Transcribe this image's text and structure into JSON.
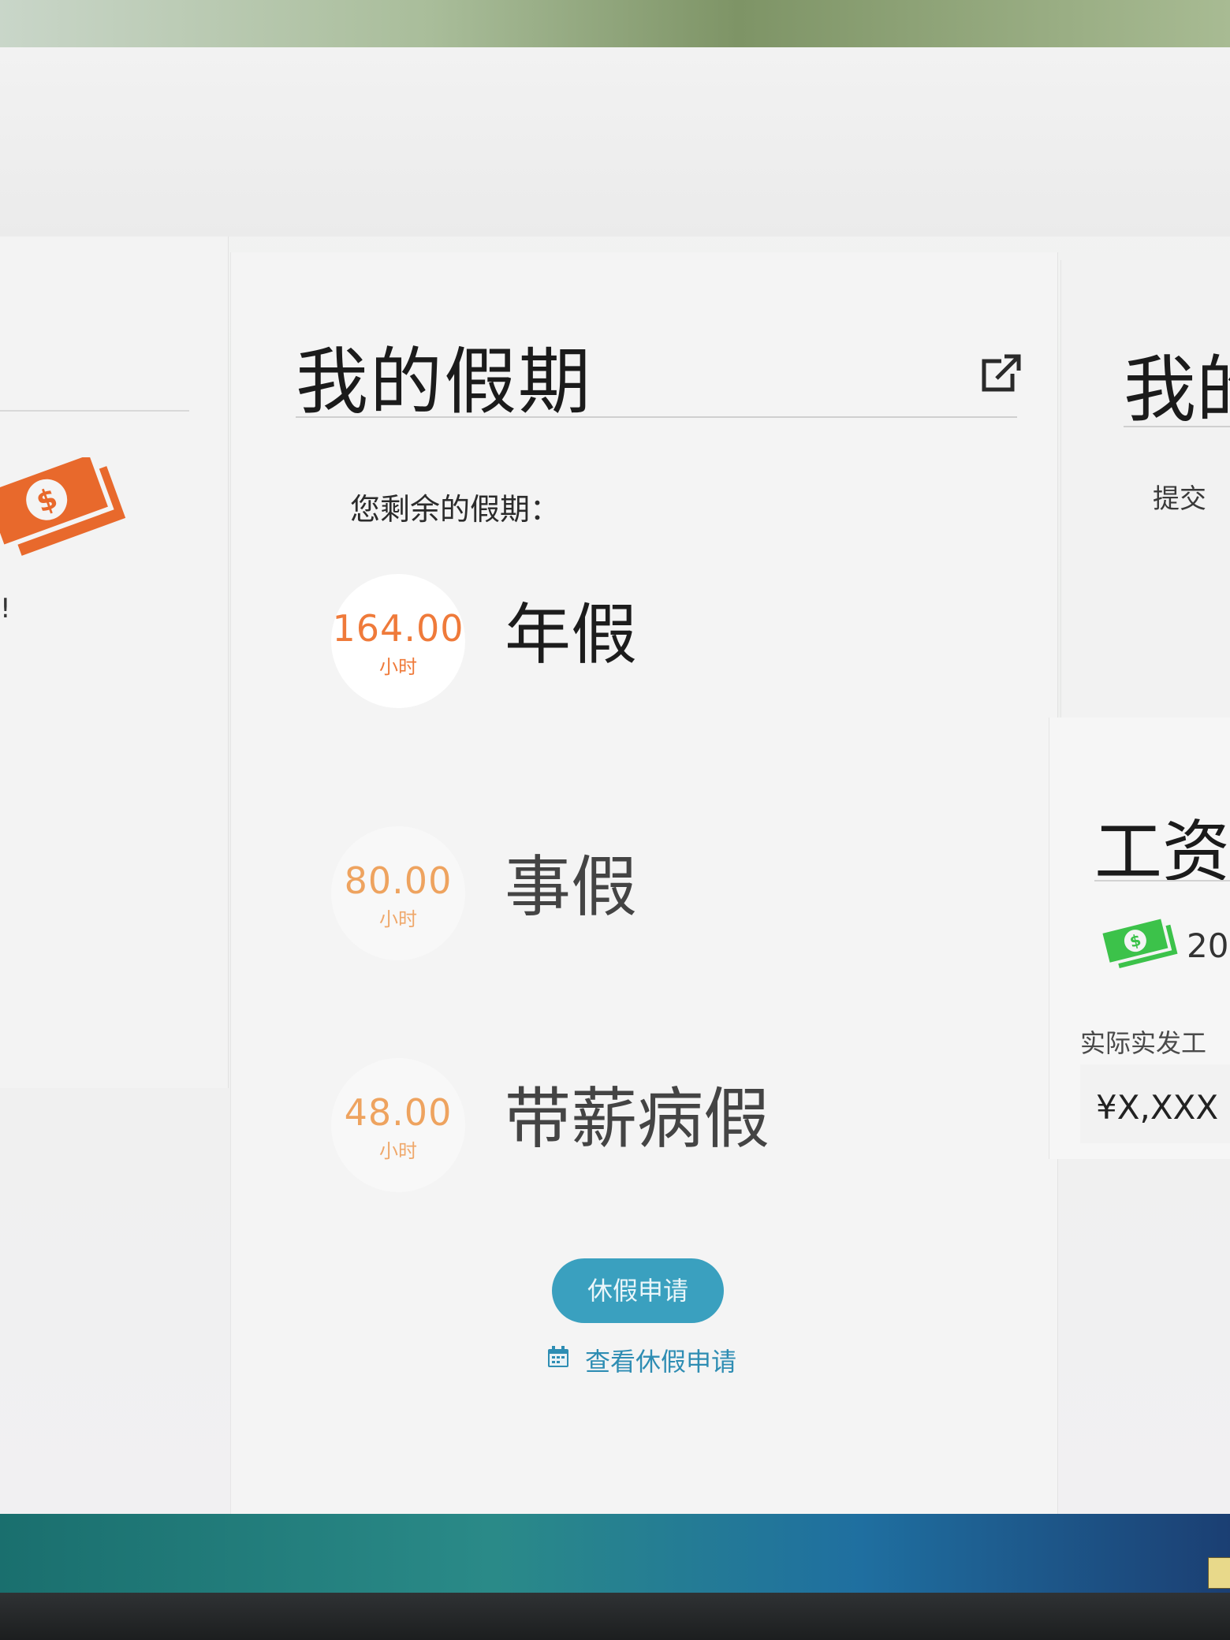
{
  "vacation_card": {
    "title": "我的假期",
    "remaining_label": "您剩余的假期：",
    "leaves": [
      {
        "hours": "164.00",
        "unit": "小时",
        "name": "年假"
      },
      {
        "hours": "80.00",
        "unit": "小时",
        "name": "事假"
      },
      {
        "hours": "48.00",
        "unit": "小时",
        "name": "带薪病假"
      }
    ],
    "apply_button": "休假申请",
    "view_link": "查看休假申请"
  },
  "left_card": {
    "exclaim": "!"
  },
  "right_card": {
    "title": "我的",
    "subtitle": "提交"
  },
  "salary_card": {
    "title": "工资",
    "year": "20",
    "label": "实际实发工",
    "amount": "¥X,XXX"
  },
  "colors": {
    "accent_orange": "#ef7a3a",
    "button_blue": "#3aa0bf",
    "link_blue": "#2e8db3",
    "money_orange": "#e8692c",
    "money_green": "#3cc24a"
  },
  "icons": [
    "money-icon",
    "external-link-icon",
    "calendar-icon"
  ]
}
